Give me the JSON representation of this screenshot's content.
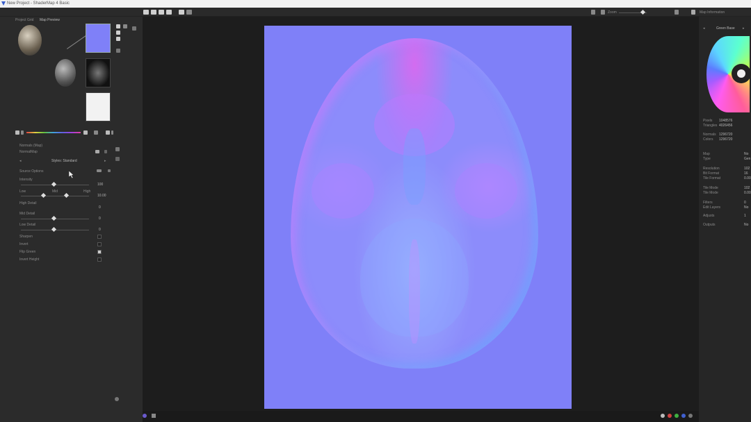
{
  "window": {
    "title": "New Project - ShaderMap 4 Basic"
  },
  "left_panel": {
    "tabs": [
      "Project Grid",
      "Map Preview"
    ],
    "section_title": "Normals (Map)",
    "subtitle": "NormalMap",
    "styles_label": "Styles: Standard",
    "source_options_label": "Source Options",
    "intensity_label": "Intensity",
    "intensity_value": "100",
    "range_labels": [
      "Low",
      "Mid",
      "High"
    ],
    "range_value": "10.00",
    "high_detail_label": "High Detail",
    "high_detail_value": "0",
    "mid_detail_label": "Mid Detail",
    "mid_detail_value": "0",
    "low_detail_label": "Low Detail",
    "low_detail_value": "0",
    "checkboxes": [
      {
        "label": "Sharpen",
        "checked": false
      },
      {
        "label": "Invert",
        "checked": false
      },
      {
        "label": "Flip Green",
        "checked": true
      },
      {
        "label": "Invert Height",
        "checked": false
      }
    ],
    "palette_colors": [
      "#e04040",
      "#e08040",
      "#e0d040",
      "#60c040",
      "#40a0e0",
      "#6060e0",
      "#a040e0",
      "#e040a0"
    ]
  },
  "toolbar": {
    "zoom_label": "Zoom",
    "right_label": "Map Information",
    "right_tab": "Green Base"
  },
  "right_panel": {
    "info_rows": [
      {
        "label": "Pixels",
        "value": "1048576"
      },
      {
        "label": "Triangles",
        "value": "4026456"
      },
      {
        "label": "Normals",
        "value": "1296720"
      },
      {
        "label": "Colors",
        "value": "1296720"
      }
    ],
    "rows2": [
      {
        "label": "Map",
        "value": "No"
      },
      {
        "label": "Type",
        "value": "Gen"
      }
    ],
    "rows3": [
      {
        "label": "Resolution",
        "value": "102"
      },
      {
        "label": "Bit Format",
        "value": "16"
      },
      {
        "label": "Tile Format",
        "value": "0.00"
      }
    ],
    "rows4": [
      {
        "label": "Tile Mode",
        "value": "102"
      },
      {
        "label": "Tile Mode",
        "value": "0.00"
      }
    ],
    "rows5": [
      {
        "label": "Filters",
        "value": "0"
      },
      {
        "label": "Edit Layers",
        "value": "No"
      }
    ],
    "rows6": [
      {
        "label": "Adjusts",
        "value": "1"
      },
      {
        "label": "Outputs",
        "value": "No"
      }
    ]
  },
  "colors": {
    "normal_map_base": "#7f80f8",
    "accent": "#3a5fcd"
  }
}
